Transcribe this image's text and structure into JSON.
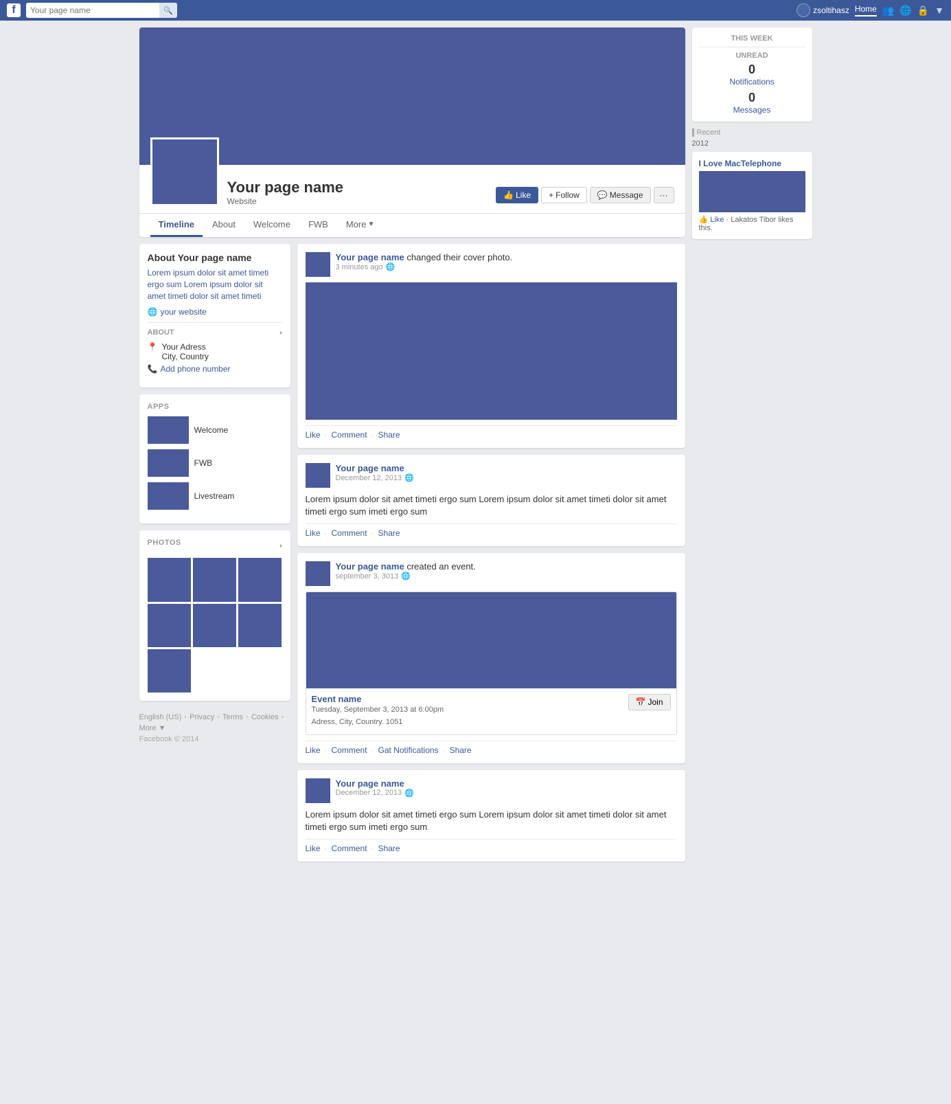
{
  "topnav": {
    "search_placeholder": "Your page name",
    "user": "zsoltihasz",
    "home": "Home",
    "fb_letter": "f"
  },
  "cover": {
    "page_name": "Your page name",
    "website": "Website",
    "btn_like": "Like",
    "btn_follow": "Follow",
    "btn_message": "Message",
    "btn_more": "···"
  },
  "tabs": [
    {
      "label": "Timeline",
      "active": true
    },
    {
      "label": "About",
      "active": false
    },
    {
      "label": "Welcome",
      "active": false
    },
    {
      "label": "FWB",
      "active": false
    },
    {
      "label": "More",
      "active": false
    }
  ],
  "sidebar": {
    "about_title": "About Your page name",
    "about_text": "Lorem ipsum dolor sit amet timeti ergo sum Lorem ipsum dolor sit amet timeti dolor sit amet timeti",
    "website": "your website",
    "about_section": "ABOUT",
    "address_line1": "Your Adress",
    "address_line2": "City, Country",
    "add_phone": "Add phone number",
    "apps_section": "APPS",
    "apps": [
      {
        "name": "Welcome"
      },
      {
        "name": "FWB"
      },
      {
        "name": "Livestream"
      }
    ],
    "photos_section": "PHOTOS"
  },
  "feed": {
    "posts": [
      {
        "author": "Your page name",
        "action": "changed their cover photo.",
        "time": "3 minutes ago",
        "has_image": true,
        "actions": [
          "Like",
          "Comment",
          "Share"
        ]
      },
      {
        "author": "Your page name",
        "time": "December 12, 2013",
        "text": "Lorem ipsum dolor sit amet timeti ergo sum Lorem ipsum dolor sit amet timeti dolor sit amet timeti ergo sum imeti ergo sum",
        "has_image": false,
        "actions": [
          "Like",
          "Comment",
          "Share"
        ]
      },
      {
        "author": "Your page name",
        "action": "created an event.",
        "time": "september 3, 3013",
        "has_event": true,
        "event_name": "Event name",
        "event_date": "Tuesday, September 3, 2013 at 6:00pm",
        "event_address": "Adress, City, Country. 1051",
        "btn_join": "Join",
        "actions": [
          "Like",
          "Comment",
          "Gat Notifications",
          "Share"
        ]
      },
      {
        "author": "Your page name",
        "time": "December 12, 2013",
        "text": "Lorem ipsum dolor sit amet timeti ergo sum Lorem ipsum dolor sit amet timeti dolor sit amet timeti ergo sum imeti ergo sum",
        "has_image": false,
        "actions": [
          "Like",
          "Comment",
          "Share"
        ]
      }
    ]
  },
  "right_sidebar": {
    "this_week": "THIS WEEK",
    "unread": "UNREAD",
    "notifications_count": "0",
    "notifications_label": "Notifications",
    "messages_count": "0",
    "messages_label": "Messages",
    "recent": "Recent",
    "year": "2012",
    "sponsored_name": "I Love MacTelephone",
    "like_text": "Like",
    "lakatos": "· Lakatos Tibor likes this."
  },
  "footer": {
    "links": [
      "English (US)",
      "Privacy",
      "Terms",
      "Cookies",
      "More"
    ],
    "copyright": "Facebook © 2014"
  }
}
